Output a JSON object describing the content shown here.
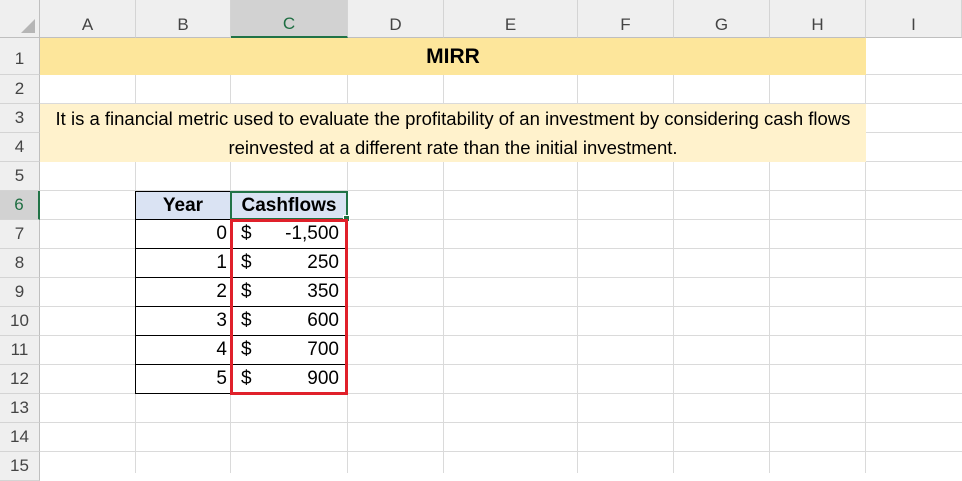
{
  "columns": [
    "A",
    "B",
    "C",
    "D",
    "E",
    "F",
    "G",
    "H",
    "I"
  ],
  "rows": [
    "1",
    "2",
    "3",
    "4",
    "5",
    "6",
    "7",
    "8",
    "9",
    "10",
    "11",
    "12",
    "13",
    "14",
    "15"
  ],
  "selected_column": "C",
  "selected_row": "6",
  "title": "MIRR",
  "description": "It is a financial metric used to evaluate the profitability of an investment by considering cash flows reinvested at a different rate than the initial investment.",
  "table": {
    "headers": [
      "Year",
      "Cashflows"
    ],
    "currency_symbol": "$",
    "rows": [
      {
        "year": "0",
        "cashflow": "-1,500"
      },
      {
        "year": "1",
        "cashflow": "250"
      },
      {
        "year": "2",
        "cashflow": "350"
      },
      {
        "year": "3",
        "cashflow": "600"
      },
      {
        "year": "4",
        "cashflow": "700"
      },
      {
        "year": "5",
        "cashflow": "900"
      }
    ]
  },
  "colors": {
    "title_fill": "#fde69b",
    "description_fill": "#fff2cc",
    "table_header_fill": "#dae3f3",
    "highlight_border": "#e0202a",
    "selection_accent": "#217346"
  }
}
